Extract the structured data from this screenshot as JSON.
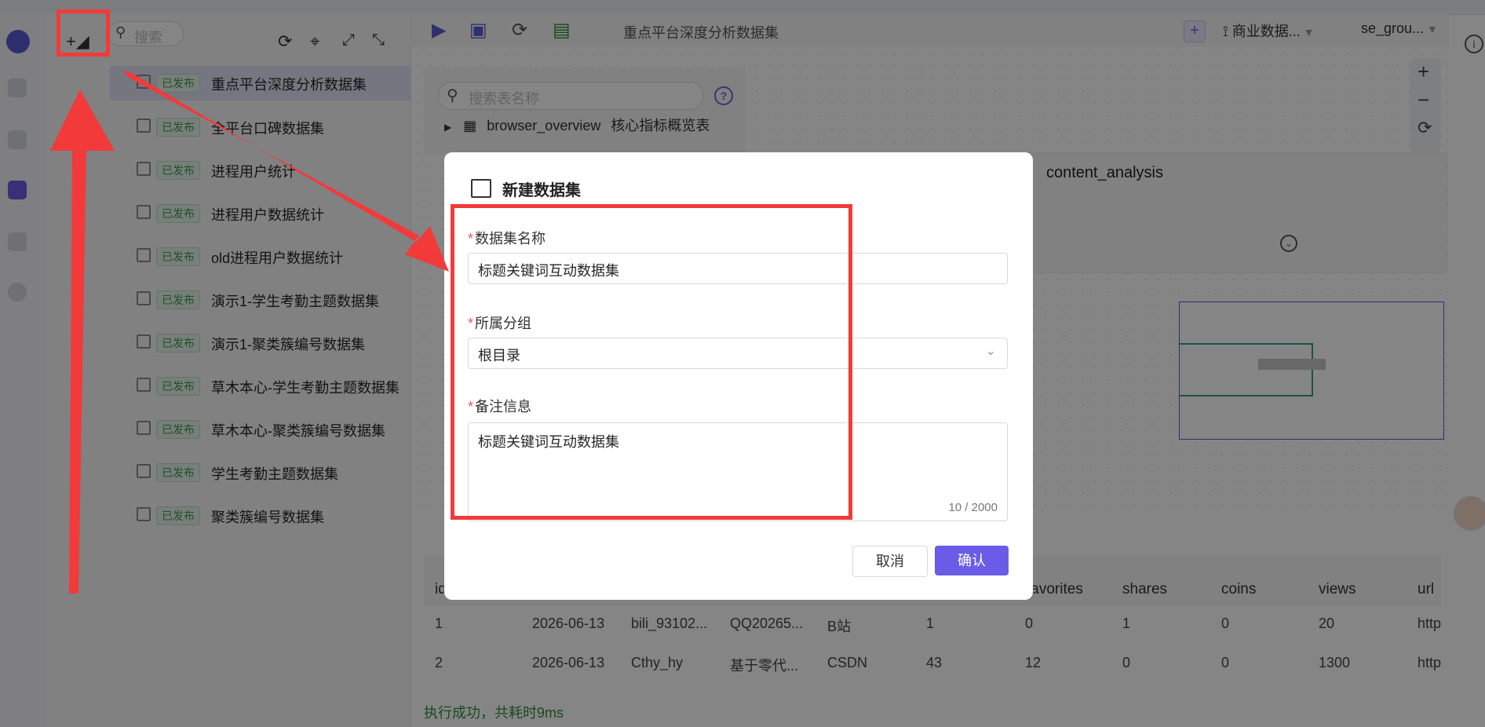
{
  "toolbar": {
    "search_placeholder": "搜索",
    "dataset_title": "重点平台深度分析数据集",
    "business_label": "商业数据...",
    "group_label": "se_grou..."
  },
  "tree": {
    "items": [
      {
        "status": "已发布",
        "label": "重点平台深度分析数据集"
      },
      {
        "status": "已发布",
        "label": "全平台口碑数据集"
      },
      {
        "status": "已发布",
        "label": "进程用户统计"
      },
      {
        "status": "已发布",
        "label": "进程用户数据统计"
      },
      {
        "status": "已发布",
        "label": "old进程用户数据统计"
      },
      {
        "status": "已发布",
        "label": "演示1-学生考勤主题数据集"
      },
      {
        "status": "已发布",
        "label": "演示1-聚类簇编号数据集"
      },
      {
        "status": "已发布",
        "label": "草木本心-学生考勤主题数据集"
      },
      {
        "status": "已发布",
        "label": "草木本心-聚类簇编号数据集"
      },
      {
        "status": "已发布",
        "label": "学生考勤主题数据集"
      },
      {
        "status": "已发布",
        "label": "聚类簇编号数据集"
      }
    ]
  },
  "tables": {
    "search_placeholder": "搜索表名称",
    "item_name": "browser_overview",
    "item_desc": "核心指标概览表"
  },
  "node": {
    "name": "content_analysis"
  },
  "results": {
    "headers": [
      "id",
      "",
      "",
      "",
      "",
      "",
      "favorites",
      "shares",
      "coins",
      "views",
      "url"
    ],
    "rows": [
      [
        "1",
        "2026-06-13",
        "bili_93102...",
        "QQ20265...",
        "B站",
        "1",
        "0",
        "1",
        "0",
        "20",
        "http"
      ],
      [
        "2",
        "2026-06-13",
        "Cthy_hy",
        "基于零代...",
        "CSDN",
        "43",
        "12",
        "0",
        "0",
        "1300",
        "http"
      ]
    ],
    "status": "执行成功，共耗时9ms"
  },
  "dialog": {
    "title": "新建数据集",
    "name_label": "数据集名称",
    "name_value": "标题关键词互动数据集",
    "group_label": "所属分组",
    "group_value": "根目录",
    "remark_label": "备注信息",
    "remark_value": "标题关键词互动数据集",
    "remark_count": "10 / 2000",
    "cancel": "取消",
    "confirm": "确认"
  },
  "colors": {
    "accent": "#6b5ce7",
    "annotation": "#f23a3a",
    "published": "#3a9b4e"
  }
}
